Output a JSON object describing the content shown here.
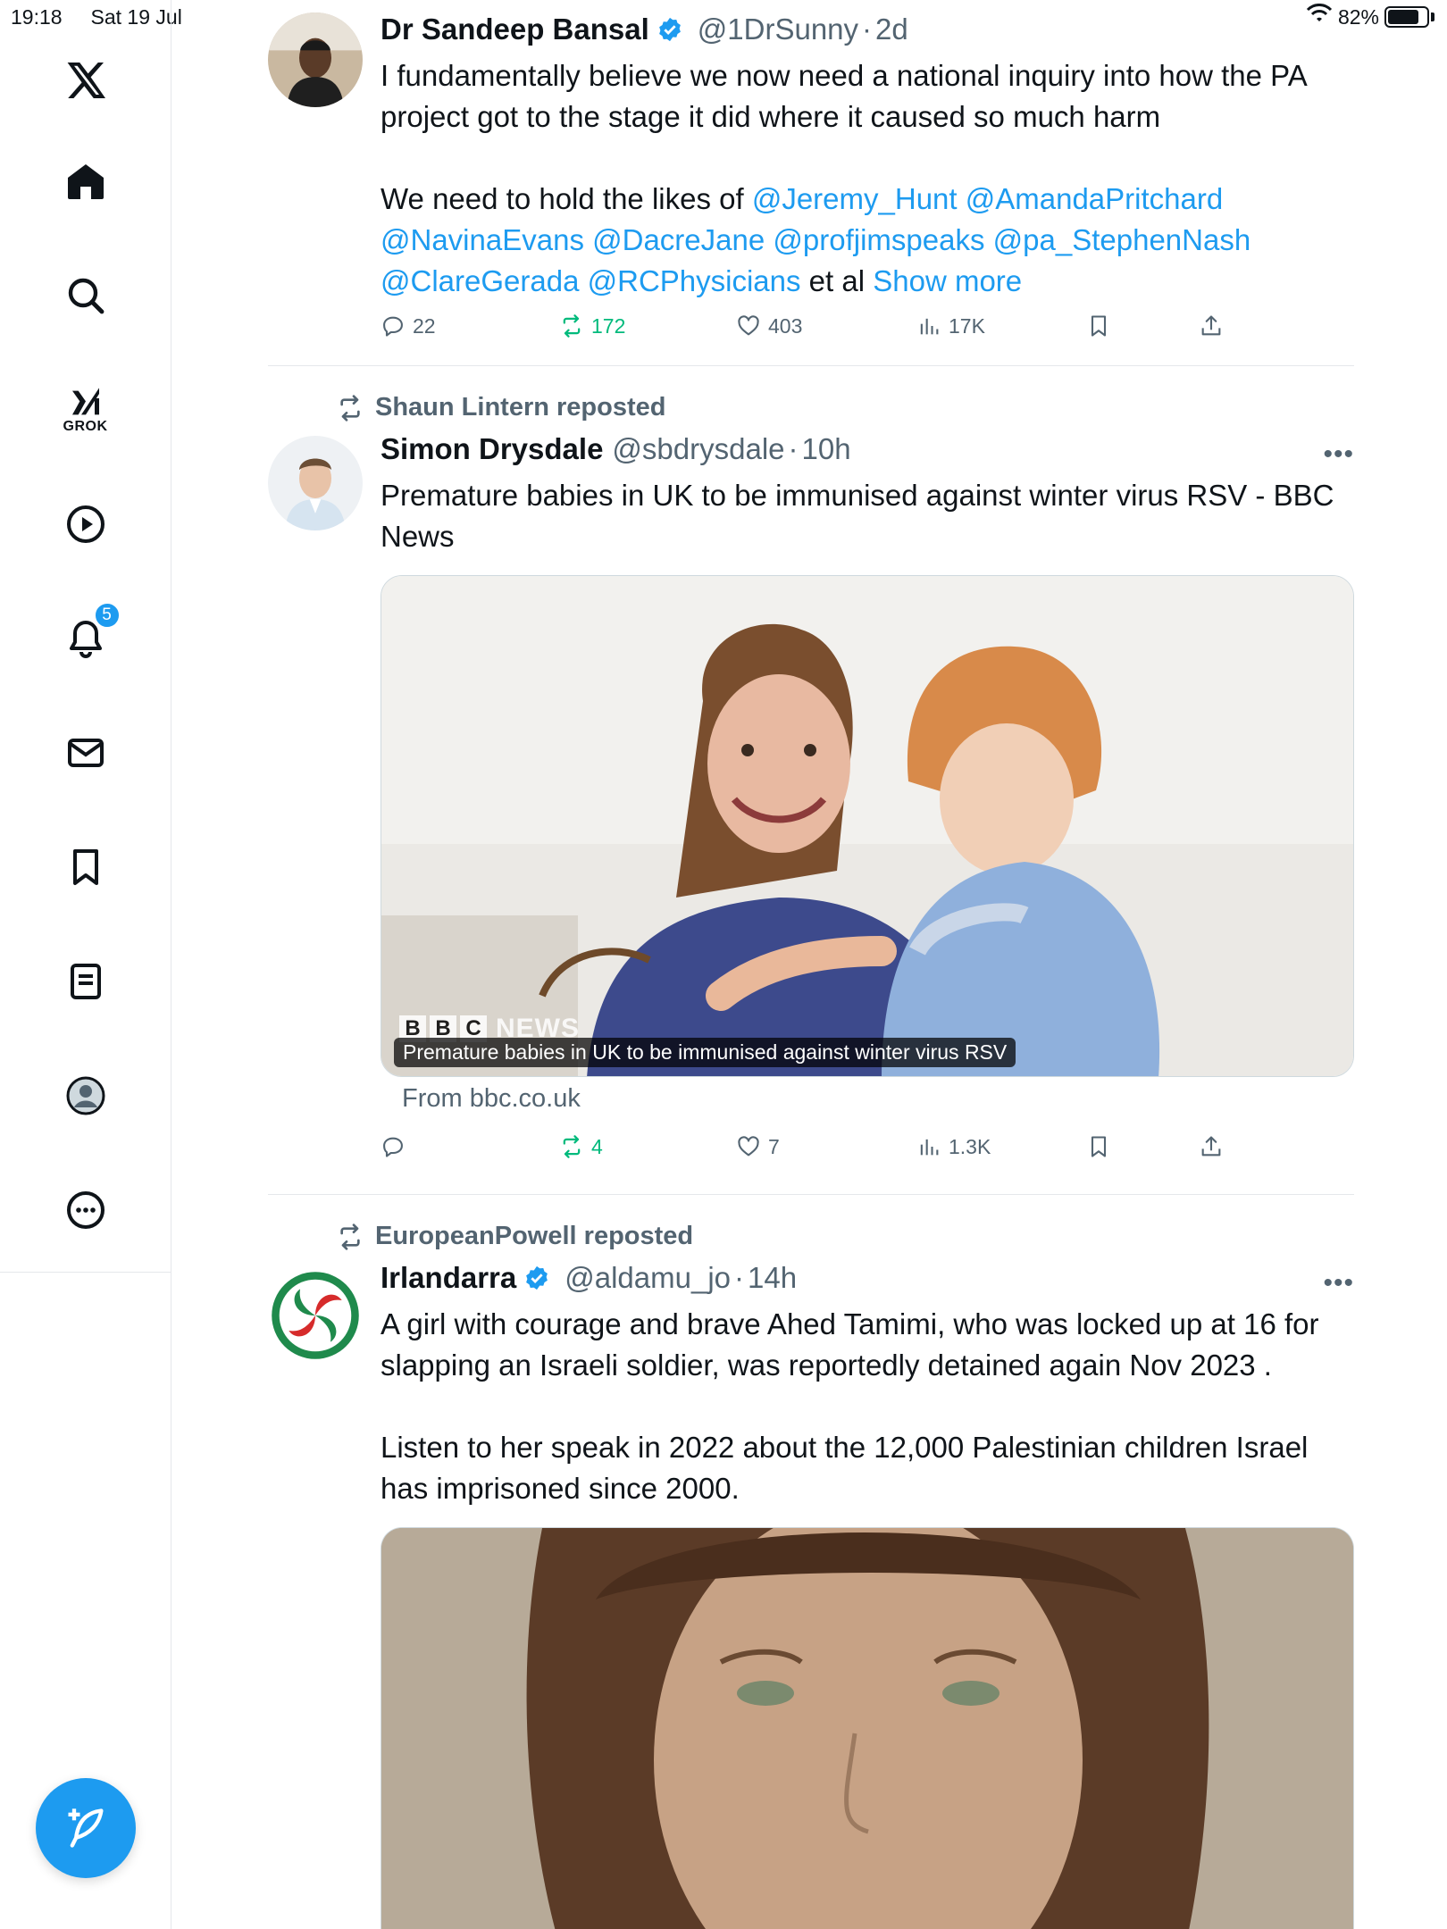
{
  "status_bar": {
    "time": "19:18",
    "date": "Sat 19 Jul",
    "battery": "82%",
    "battery_level": 0.82
  },
  "sidebar": {
    "grok_label": "GROK",
    "notifications_badge": "5"
  },
  "tweets": [
    {
      "name": "Dr Sandeep Bansal",
      "verified": true,
      "handle": "@1DrSunny",
      "time": "2d",
      "para1": "I fundamentally believe we now need a national inquiry into how the PA project got to the stage it did where it caused so much harm",
      "para2_lead": "We need to hold the likes of ",
      "mentions": [
        "@Jeremy_Hunt",
        "@AmandaPritchard",
        "@NavinaEvans",
        "@DacreJane",
        "@profjimspeaks",
        "@pa_StephenNash",
        "@ClareGerada",
        "@RCPhysicians"
      ],
      "para2_tail": " et al ",
      "show_more": "Show more",
      "replies": "22",
      "reposts": "172",
      "likes": "403",
      "views": "17K"
    },
    {
      "reposted_by": "Shaun Lintern reposted",
      "name": "Simon Drysdale",
      "verified": false,
      "handle": "@sbdrysdale",
      "time": "10h",
      "text": "Premature babies in UK to be immunised against winter virus RSV - BBC News",
      "card": {
        "caption": "Premature babies in UK to be immunised against winter virus RSV",
        "logo_letters": [
          "B",
          "B",
          "C"
        ],
        "logo_word": "NEWS",
        "source": "From bbc.co.uk"
      },
      "replies": "",
      "reposts": "4",
      "likes": "7",
      "views": "1.3K"
    },
    {
      "reposted_by": "EuropeanPowell reposted",
      "name": "Irlandarra",
      "verified": true,
      "handle": "@aldamu_jo",
      "time": "14h",
      "para1": "A girl with courage and brave  Ahed Tamimi, who was locked up at 16 for slapping an Israeli soldier, was reportedly detained again  Nov 2023 .",
      "para2": "Listen to her speak in 2022 about the 12,000 Palestinian children Israel has imprisoned since 2000."
    }
  ],
  "colors": {
    "accent": "#1d9bf0",
    "repost_green": "#00ba7c",
    "secondary_text": "#536471",
    "border": "#e5e7eb"
  }
}
